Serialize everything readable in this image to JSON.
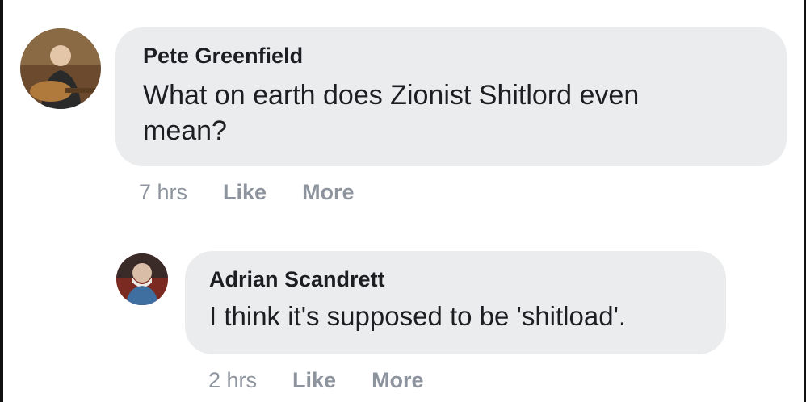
{
  "comments": [
    {
      "author": "Pete Greenfield",
      "text": "What on earth does Zionist Shitlord even mean?",
      "time": "7 hrs",
      "like_label": "Like",
      "more_label": "More"
    },
    {
      "author": "Adrian Scandrett",
      "text": "I think it's supposed to be 'shitload'.",
      "time": "2 hrs",
      "like_label": "Like",
      "more_label": "More"
    }
  ],
  "colors": {
    "bubble": "#ebecee",
    "text": "#1c1e21",
    "meta": "#8d949e"
  }
}
